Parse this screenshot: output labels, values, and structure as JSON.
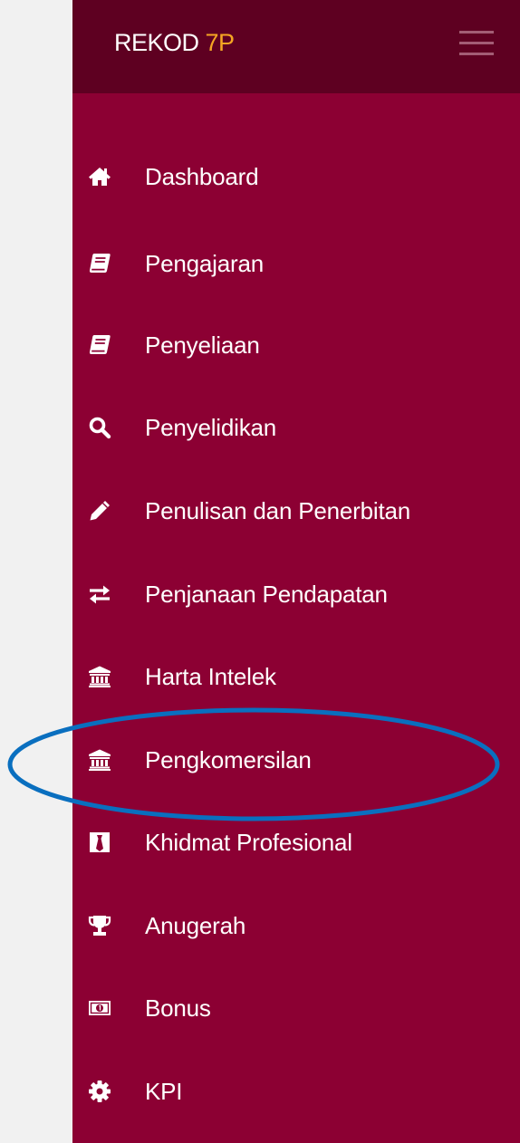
{
  "app": {
    "brand_prefix": "REKOD ",
    "brand_accent": "7P"
  },
  "colors": {
    "sidebar_background": "#8c0033",
    "header_background": "#5e0021",
    "brand_accent": "#f5a623",
    "highlight_ring": "#0a6fbf",
    "page_background": "#f1f1f1"
  },
  "sidebar": {
    "toggle_icon": "hamburger-icon",
    "items": [
      {
        "label": "Dashboard",
        "icon": "home-icon"
      },
      {
        "label": "Pengajaran",
        "icon": "book-icon"
      },
      {
        "label": "Penyeliaan",
        "icon": "book-icon"
      },
      {
        "label": "Penyelidikan",
        "icon": "search-icon"
      },
      {
        "label": "Penulisan dan Penerbitan",
        "icon": "pencil-icon"
      },
      {
        "label": "Penjanaan Pendapatan",
        "icon": "exchange-icon"
      },
      {
        "label": "Harta Intelek",
        "icon": "institution-icon"
      },
      {
        "label": "Pengkomersilan",
        "icon": "institution-icon"
      },
      {
        "label": "Khidmat Profesional",
        "icon": "black-tie-icon"
      },
      {
        "label": "Anugerah",
        "icon": "trophy-icon"
      },
      {
        "label": "Bonus",
        "icon": "money-icon"
      },
      {
        "label": "KPI",
        "icon": "gear-icon"
      }
    ],
    "highlighted_item": "Pengkomersilan"
  }
}
